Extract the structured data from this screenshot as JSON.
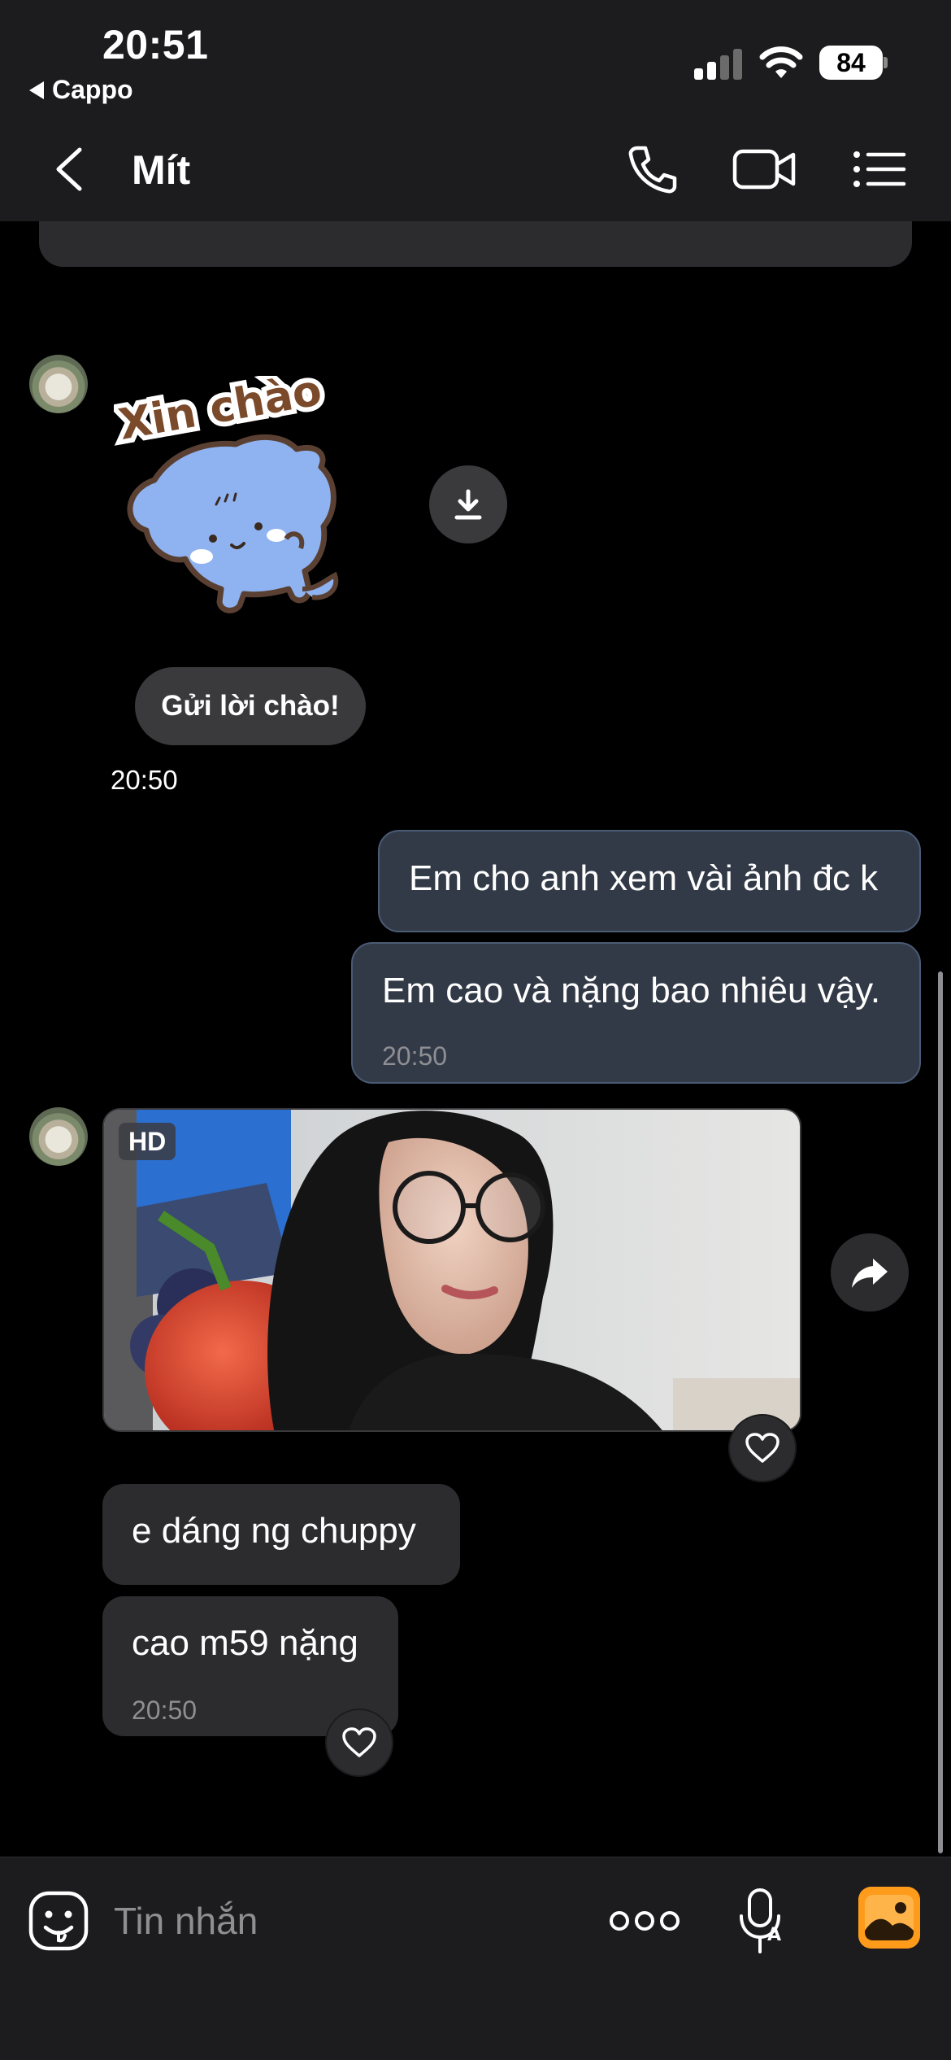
{
  "status_bar": {
    "time": "20:51",
    "back_app": "Cappo",
    "battery": "84"
  },
  "nav": {
    "title": "Mít",
    "icons": [
      "back-chevron-icon",
      "phone-icon",
      "video-camera-icon",
      "list-menu-icon"
    ]
  },
  "messages": {
    "sticker": {
      "caption": "Xin chào"
    },
    "greet_button": "Gửi lời chào!",
    "time_1": "20:50",
    "outgoing": [
      {
        "text": "Em cho anh xem vài ảnh đc k"
      },
      {
        "text": "Em cao và nặng bao nhiêu vậy.",
        "time": "20:50"
      }
    ],
    "photo": {
      "badge": "HD"
    },
    "incoming": [
      {
        "text": "e dáng ng chuppy"
      },
      {
        "text": "cao m59 nặng",
        "time": "20:50"
      }
    ]
  },
  "composer": {
    "placeholder": "Tin nhắn",
    "icons": [
      "sticker-face-icon",
      "more-dots-icon",
      "voice-to-text-mic-icon",
      "gallery-icon"
    ]
  },
  "colors": {
    "background": "#000000",
    "header_bg": "#1c1c1e",
    "outgoing_bubble": "#323a47",
    "outgoing_border": "#4a5b75",
    "incoming_bubble": "#2c2c2e",
    "gallery_accent": "#ff9b1a"
  }
}
